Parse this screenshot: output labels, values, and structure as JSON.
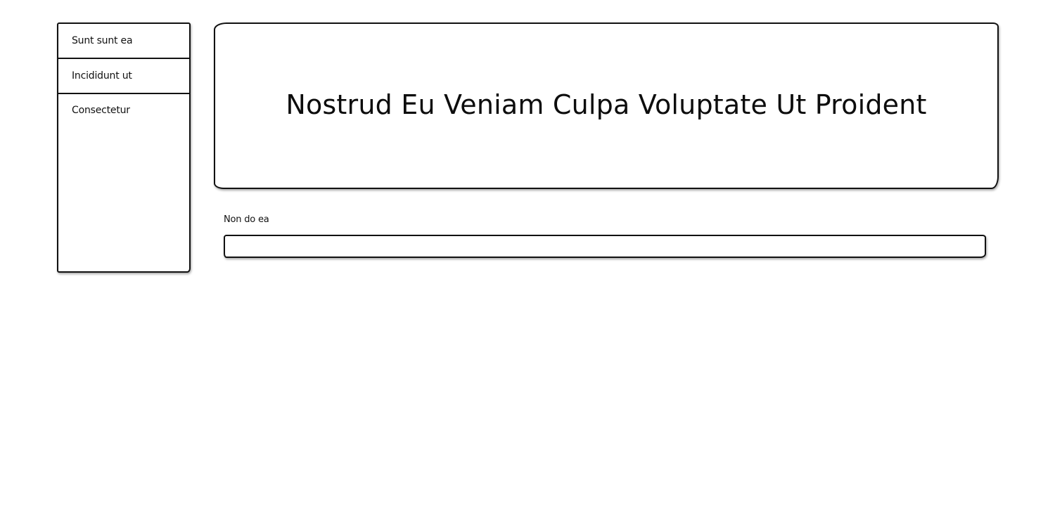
{
  "sidebar": {
    "items": [
      {
        "label": "Sunt sunt ea"
      },
      {
        "label": "Incididunt ut"
      },
      {
        "label": "Consectetur"
      }
    ]
  },
  "header": {
    "title": "Nostrud Eu Veniam Culpa Voluptate Ut Proident"
  },
  "form": {
    "field_label": "Non do ea",
    "field_value": "",
    "field_placeholder": ""
  }
}
